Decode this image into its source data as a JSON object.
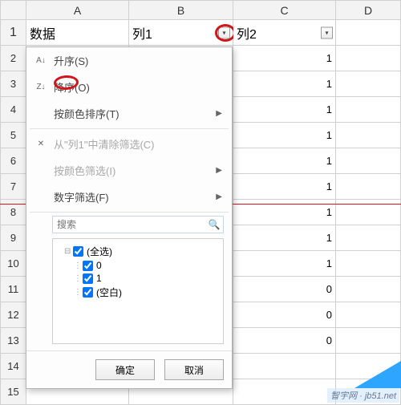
{
  "columns": [
    "A",
    "B",
    "C",
    "D"
  ],
  "row_numbers": [
    1,
    2,
    3,
    4,
    5,
    6,
    7,
    8,
    9,
    10,
    11,
    12,
    13,
    14,
    15
  ],
  "headers": {
    "A": "数据",
    "B": "列1",
    "C": "列2"
  },
  "values_C": [
    "1",
    "1",
    "1",
    "1",
    "1",
    "1",
    "1",
    "1",
    "1",
    "0",
    "0",
    "0"
  ],
  "menu": {
    "sort_asc": "升序(S)",
    "sort_desc": "降序(O)",
    "sort_color": "按颜色排序(T)",
    "clear_filter": "从\"列1\"中清除筛选(C)",
    "filter_color": "按颜色筛选(I)",
    "num_filter": "数字筛选(F)",
    "search_placeholder": "搜索",
    "items": {
      "all": "(全选)",
      "v0": "0",
      "v1": "1",
      "blank": "(空白)"
    },
    "ok": "确定",
    "cancel": "取消"
  },
  "watermark": "智宇网 · jb51.net"
}
